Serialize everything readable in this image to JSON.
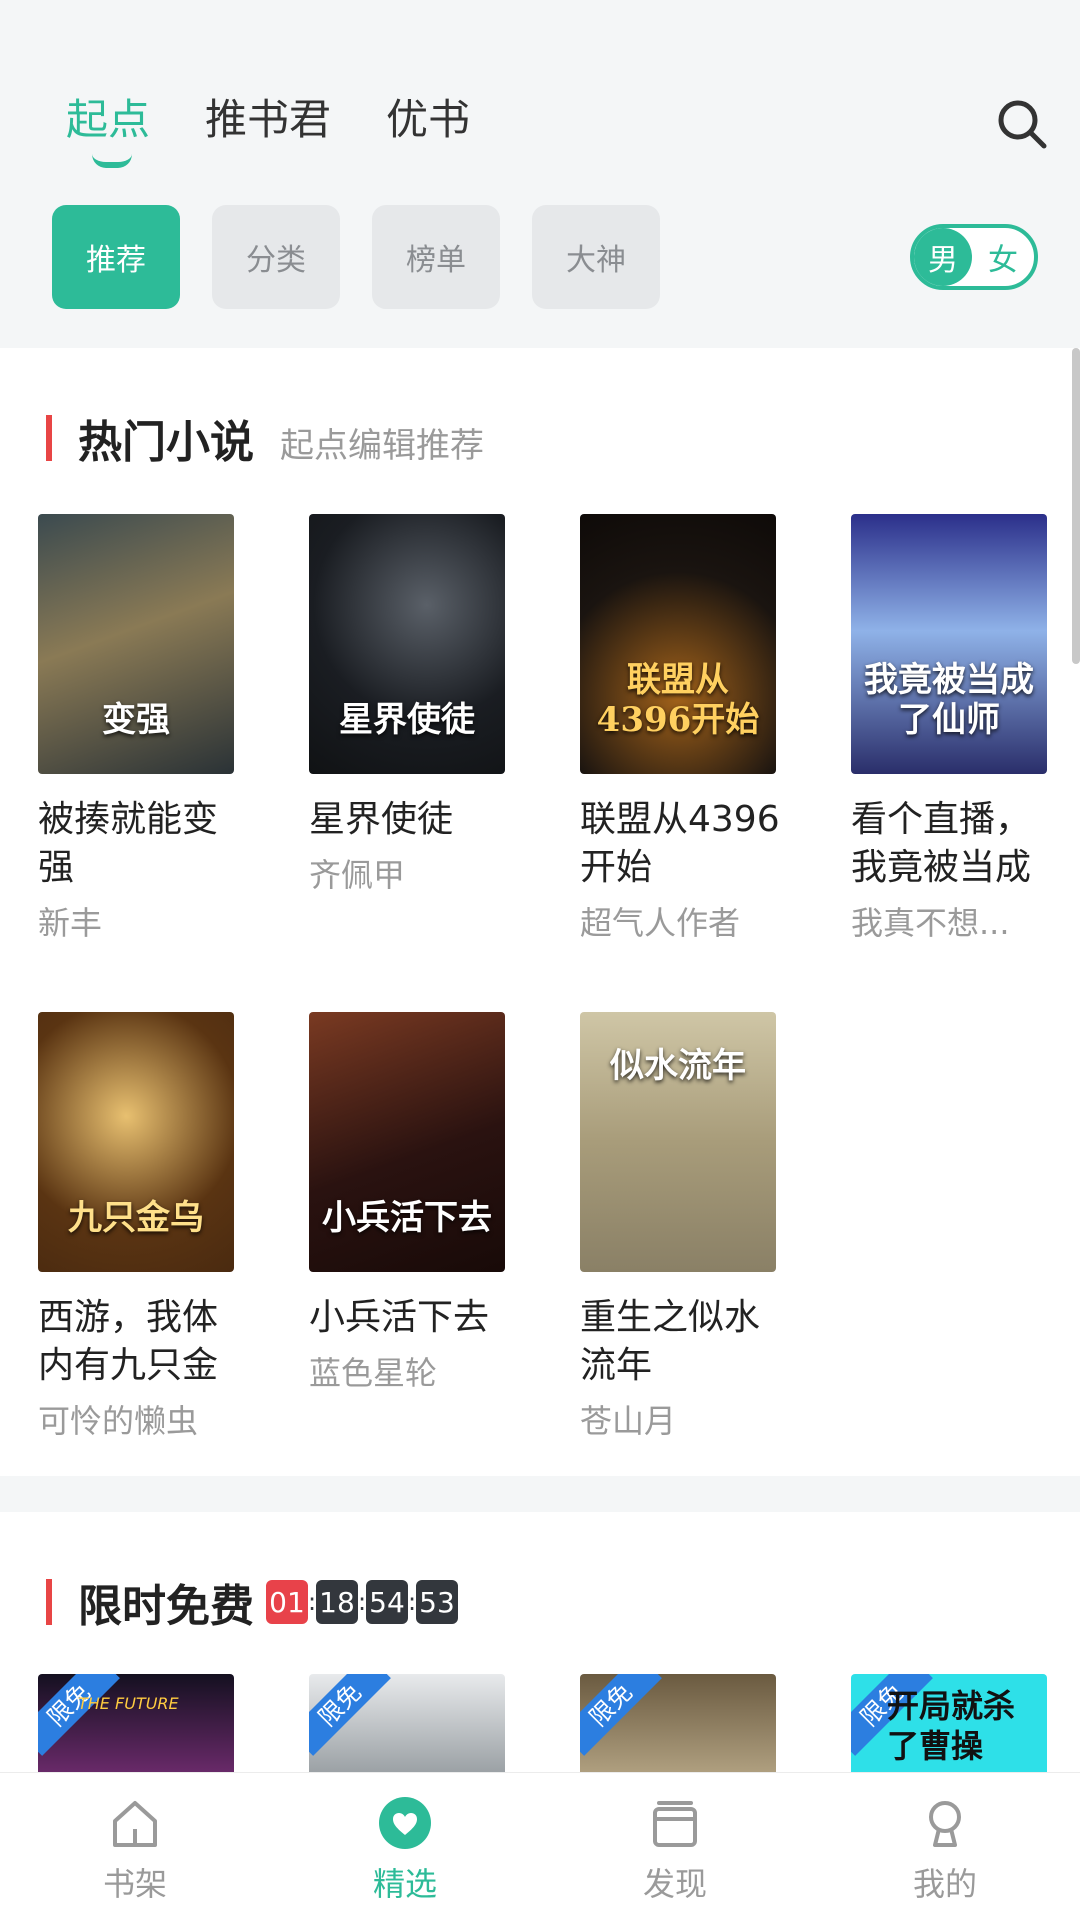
{
  "header": {
    "tabs": [
      {
        "label": "起点",
        "active": true
      },
      {
        "label": "推书君",
        "active": false
      },
      {
        "label": "优书",
        "active": false
      }
    ],
    "pills": [
      {
        "label": "推荐",
        "active": true
      },
      {
        "label": "分类",
        "active": false
      },
      {
        "label": "榜单",
        "active": false
      },
      {
        "label": "大神",
        "active": false
      }
    ],
    "gender": {
      "male": "男",
      "female": "女",
      "selected": "男"
    }
  },
  "hot": {
    "title": "热门小说",
    "subtitle": "起点编辑推荐",
    "books": [
      {
        "title": "被揍就能变强",
        "author": "新丰",
        "cover_text": "变强",
        "cover_colors": [
          "#3b4a4f",
          "#8a7a55",
          "#2a3236"
        ]
      },
      {
        "title": "星界使徒",
        "author": "齐佩甲",
        "cover_text": "星界使徒",
        "cover_colors": [
          "#1a1d22",
          "#5a6068",
          "#101214"
        ]
      },
      {
        "title": "联盟从4396开始",
        "author": "超气人作者",
        "cover_text": "联盟从4396开始",
        "cover_colors": [
          "#1a1410",
          "#a2621a",
          "#0e0a08"
        ]
      },
      {
        "title": "看个直播，我竟被当成",
        "author": "我真不想...",
        "cover_text": "我竟被当成了仙师",
        "cover_colors": [
          "#2b2f8a",
          "#8fb2e8",
          "#2a2e6a"
        ]
      },
      {
        "title": "西游，我体内有九只金",
        "author": "可怜的懒虫",
        "cover_text": "九只金乌",
        "cover_colors": [
          "#5a3412",
          "#e8c070",
          "#4a2a10"
        ]
      },
      {
        "title": "小兵活下去",
        "author": "蓝色星轮",
        "cover_text": "小兵活下去",
        "cover_colors": [
          "#2a1210",
          "#7a3a22",
          "#180a08"
        ]
      },
      {
        "title": "重生之似水流年",
        "author": "苍山月",
        "cover_text": "似水流年",
        "cover_colors": [
          "#cfc6a6",
          "#8a8066",
          "#a89c7a"
        ]
      }
    ]
  },
  "free": {
    "title": "限时免费",
    "countdown": [
      "01",
      "18",
      "54",
      "53"
    ],
    "badge": "限免",
    "covers": [
      {
        "text": "THE FUTURE",
        "colors": [
          "#141020",
          "#6a2a6a"
        ]
      },
      {
        "text": "",
        "colors": [
          "#e8eaec",
          "#9aa0a4"
        ]
      },
      {
        "text": "",
        "colors": [
          "#6a5a40",
          "#b0a080"
        ]
      },
      {
        "text": "开局就杀了曹操",
        "colors": [
          "#2ee0e8",
          "#18c0c8"
        ]
      }
    ]
  },
  "bottom_nav": [
    {
      "label": "书架",
      "icon": "home-icon",
      "active": false
    },
    {
      "label": "精选",
      "icon": "heart-icon",
      "active": true
    },
    {
      "label": "发现",
      "icon": "cards-icon",
      "active": false
    },
    {
      "label": "我的",
      "icon": "profile-icon",
      "active": false
    }
  ],
  "colors": {
    "accent": "#2dbb98",
    "section_bar": "#e84545"
  }
}
